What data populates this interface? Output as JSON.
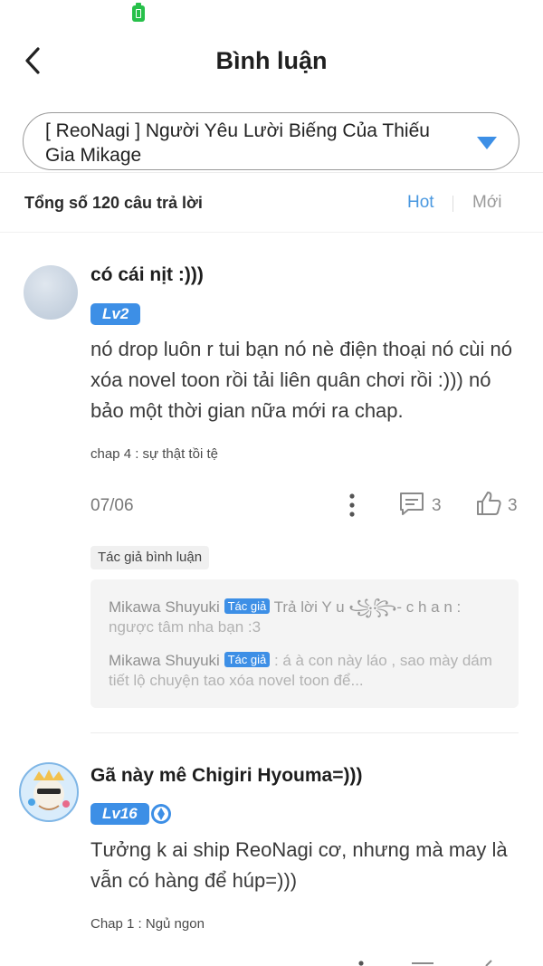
{
  "header": {
    "title": "Bình luận"
  },
  "story_select": {
    "value": "[ ReoNagi ] Người Yêu Lười Biếng Của Thiếu Gia Mikage"
  },
  "list": {
    "total": "Tổng số 120 câu trả lời",
    "sort_hot": "Hot",
    "sort_new": "Mới"
  },
  "comments": [
    {
      "username": "có cái nịt :)))",
      "level": "Lv2",
      "body": "nó drop luôn r tui bạn nó nè điện thoại nó cùi nó xóa novel toon rồi tải liên quân chơi rồi :))) nó bảo một thời gian nữa mới ra chap.",
      "chapter": "chap 4 : sự thật tồi tệ",
      "date": "07/06",
      "reply_count": "3",
      "like_count": "3",
      "author_tag": "Tác giả bình luận",
      "replies": [
        {
          "author": "Mikawa Shuyuki",
          "badge": "Tác giả",
          "action": "Trả lời",
          "target": "Y u ꧁꧂- c h a n :",
          "text": "ngược tâm nha bạn :3"
        },
        {
          "author": "Mikawa Shuyuki",
          "badge": "Tác giả",
          "text": ": á à con này láo , sao mày dám tiết lộ chuyện tao xóa novel toon để..."
        }
      ]
    },
    {
      "username": "Gã này mê Chigiri Hyouma=)))",
      "level": "Lv16",
      "body": "Tưởng k ai ship ReoNagi cơ, nhưng mà may là vẫn có hàng để húp=)))",
      "chapter": "Chap 1 : Ngủ ngon"
    }
  ],
  "colors": {
    "accent": "#3d8fe6",
    "sort_active": "#4a98e0",
    "battery": "#27c04a"
  }
}
